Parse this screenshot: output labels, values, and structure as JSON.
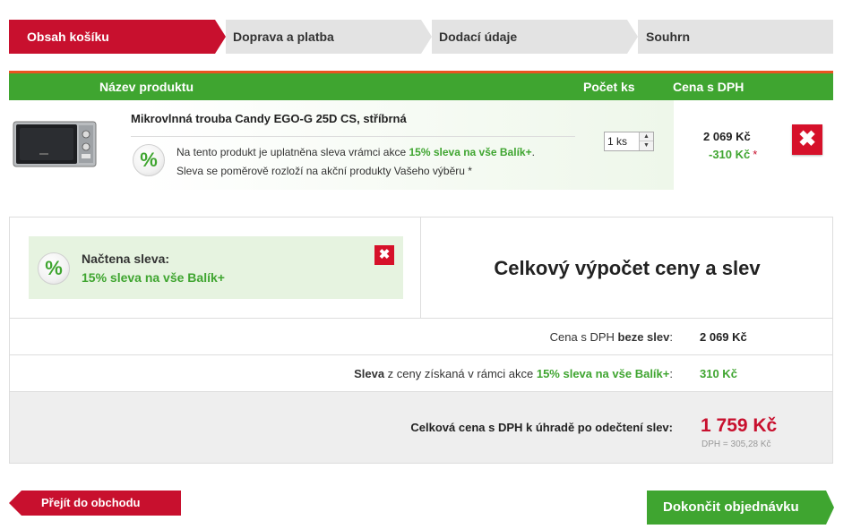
{
  "steps": [
    "Obsah košíku",
    "Doprava a platba",
    "Dodací údaje",
    "Souhrn"
  ],
  "table": {
    "col_product": "Název produktu",
    "col_qty": "Počet ks",
    "col_price": "Cena s DPH"
  },
  "product": {
    "name": "Mikrovlnná trouba Candy EGO-G 25D CS, stříbrná",
    "image_icon": "microwave-icon",
    "discount_prefix": "Na tento produkt je uplatněna sleva vrámci akce ",
    "discount_promo": "15% sleva na vše Balík+",
    "discount_suffix": ".",
    "discount_note": "Sleva se poměrově rozloží na akční produkty Vašeho výběru *",
    "badge": "%",
    "qty": "1 ks",
    "price": "2 069 Kč",
    "discount_amount": "-310 Kč",
    "asterisk": "*",
    "remove_icon": "✖"
  },
  "coupon": {
    "title": "Načtena sleva:",
    "name": "15% sleva na vše Balík+",
    "badge": "%",
    "remove_icon": "✖"
  },
  "summary": {
    "title": "Celkový výpočet ceny a slev",
    "row1_label_a": "Cena s DPH ",
    "row1_label_b": "beze slev",
    "row1_label_c": ":",
    "row1_value": "2 069 Kč",
    "row2_label_a": "Sleva",
    "row2_label_b": " z ceny získaná v rámci akce ",
    "row2_label_c": "15% sleva na vše Balík+",
    "row2_label_d": ":",
    "row2_value": "310 Kč",
    "total_label": "Celková cena s DPH k úhradě po odečtení slev:",
    "total_value": "1 759 Kč",
    "total_vat": "DPH = 305,28 Kč"
  },
  "buttons": {
    "back": "Přejít do obchodu",
    "next": "Dokončit objednávku"
  },
  "colors": {
    "red": "#c8102e",
    "green": "#3fa530",
    "orange": "#e95420"
  }
}
